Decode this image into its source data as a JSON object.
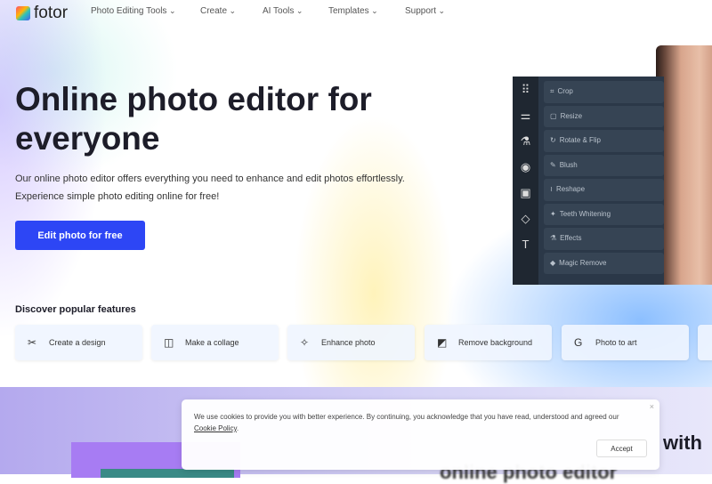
{
  "brand": {
    "name": "fotor",
    "accent": "#2d46f5"
  },
  "nav": {
    "items": [
      {
        "label": "Photo Editing Tools"
      },
      {
        "label": "Create"
      },
      {
        "label": "AI Tools"
      },
      {
        "label": "Templates"
      },
      {
        "label": "Support"
      }
    ]
  },
  "hero": {
    "title": "Online photo editor for everyone",
    "description_1": "Our online photo editor offers everything you need to enhance and edit photos effortlessly.",
    "description_2": "Experience simple photo editing online for free!",
    "cta": "Edit photo for free"
  },
  "editor": {
    "rail_icons": [
      "grid-icon",
      "sliders-icon",
      "flask-icon",
      "eye-icon",
      "frame-icon",
      "shapes-icon",
      "text-icon"
    ],
    "tools": [
      {
        "label": "Crop",
        "icon": "crop-icon"
      },
      {
        "label": "Resize",
        "icon": "resize-icon"
      },
      {
        "label": "Rotate & Flip",
        "icon": "rotate-icon"
      },
      {
        "label": "Blush",
        "icon": "blush-icon"
      },
      {
        "label": "Reshape",
        "icon": "reshape-icon"
      },
      {
        "label": "Teeth Whitening",
        "icon": "teeth-icon"
      },
      {
        "label": "Effects",
        "icon": "effects-icon"
      },
      {
        "label": "Magic Remove",
        "icon": "eraser-icon"
      }
    ]
  },
  "features": {
    "title": "Discover popular features",
    "items": [
      {
        "label": "Create a design",
        "icon": "design-icon"
      },
      {
        "label": "Make a collage",
        "icon": "collage-icon"
      },
      {
        "label": "Enhance photo",
        "icon": "enhance-icon"
      },
      {
        "label": "Remove background",
        "icon": "remove-bg-icon"
      },
      {
        "label": "Photo to art",
        "icon": "art-icon"
      }
    ]
  },
  "lower": {
    "heading_fragment": "with",
    "subheading": "online photo editor"
  },
  "cookie": {
    "text": "We use cookies to provide you with better experience. By continuing, you acknowledge that you have read, understood and agreed our ",
    "link": "Cookie Policy",
    "end": ".",
    "accept": "Accept",
    "close": "×"
  }
}
